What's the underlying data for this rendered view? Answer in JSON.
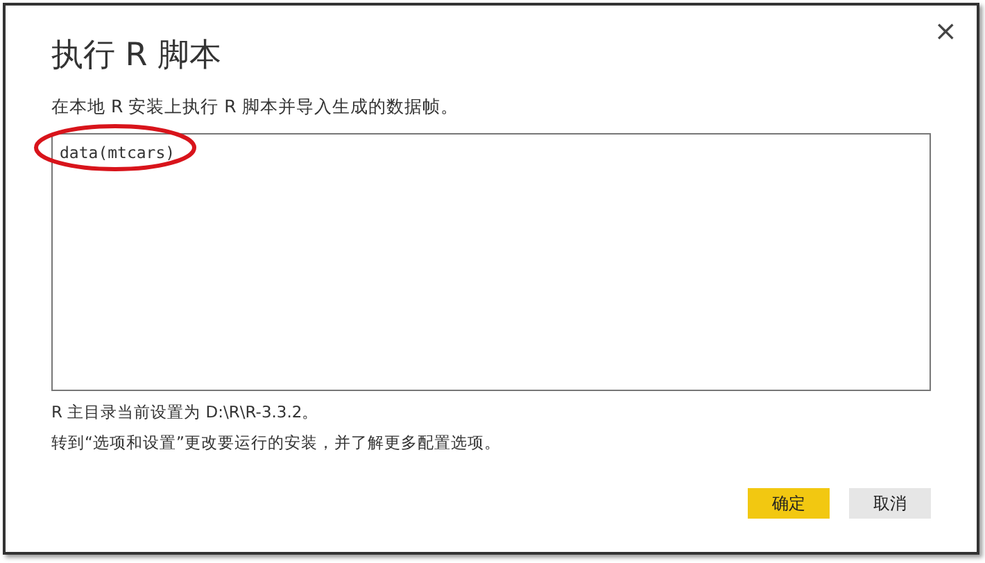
{
  "dialog": {
    "title": "执行 R 脚本",
    "close": "×",
    "description": "在本地 R 安装上执行 R 脚本并导入生成的数据帧。",
    "script": {
      "value": "data(mtcars)"
    },
    "notes": [
      "R 主目录当前设置为 D:\\R\\R-3.3.2。",
      "转到“选项和设置”更改要运行的安装，并了解更多配置选项。"
    ],
    "buttons": [
      {
        "label": "确定",
        "kind": "primary"
      },
      {
        "label": "取消",
        "kind": "secondary"
      }
    ]
  }
}
